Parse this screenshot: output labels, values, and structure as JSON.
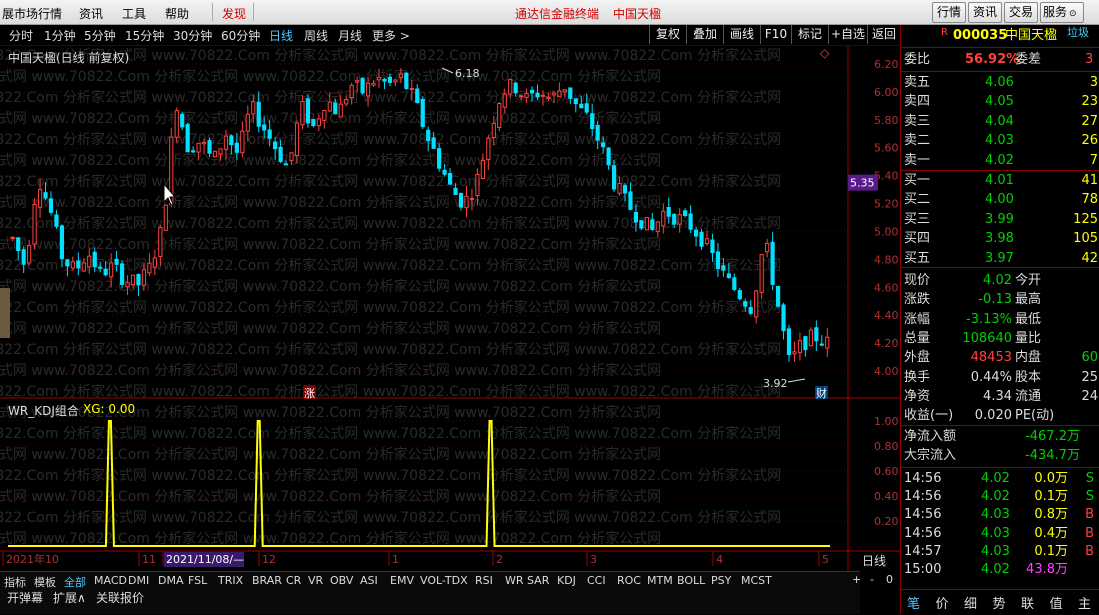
{
  "menu": {
    "items": [
      "展市场行情",
      "资讯",
      "工具",
      "帮助",
      "发现"
    ],
    "center_title": "通达信金融终端",
    "center_stock": "中国天楹",
    "right_buttons": [
      "行情",
      "资讯",
      "交易",
      "服务"
    ]
  },
  "periods": [
    "分时",
    "1分钟",
    "5分钟",
    "15分钟",
    "30分钟",
    "60分钟",
    "日线",
    "周线",
    "月线",
    "更多 >"
  ],
  "active_period": "日线",
  "toolbar_buttons": [
    "复权",
    "叠加",
    "画线",
    "F10",
    "标记",
    "+自选",
    "返回"
  ],
  "price_panel": {
    "title": "中国天楹(日线 前复权)",
    "y_ticks": [
      "6.20",
      "6.00",
      "5.80",
      "5.60",
      "5.40",
      "5.20",
      "5.00",
      "4.80",
      "4.60",
      "4.40",
      "4.20",
      "4.00"
    ],
    "current_tag": "5.35",
    "high_label": "6.18",
    "low_label": "3.92",
    "zhang_marker": "涨",
    "cai_marker": "财"
  },
  "indicator_panel": {
    "title": "WR_KDJ组合",
    "xg_label": "XG: 0.00",
    "y_ticks": [
      "1.00",
      "0.80",
      "0.60",
      "0.40",
      "0.20"
    ],
    "spikes_at": [
      0.124,
      0.305,
      0.587
    ]
  },
  "time_axis": {
    "labels": [
      "2021年10",
      "11",
      "2021/11/08/—",
      "12",
      "1",
      "2",
      "3",
      "4",
      "5"
    ],
    "right_label": "日线"
  },
  "indicator_tabs": [
    "指标",
    "模板",
    "全部",
    "MACD",
    "DMI",
    "DMA",
    "FSL",
    "TRIX",
    "BRAR",
    "CR",
    "VR",
    "OBV",
    "ASI",
    "EMV",
    "VOL-TDX",
    "RSI",
    "WR",
    "SAR",
    "KDJ",
    "CCI",
    "ROC",
    "MTM",
    "BOLL",
    "PSY",
    "MCST"
  ],
  "bottom_tabs": [
    "开弹幕",
    "扩展∧",
    "关联报价"
  ],
  "zoom_controls": [
    "+",
    "-",
    "0"
  ],
  "watermark": "www.70822.Com 分析家公式网",
  "quote": {
    "code": "000035",
    "name": "中国天楹",
    "trash_label": "垃圾",
    "r_badge": "R",
    "webi_label": "委比",
    "webi_value": "56.92%",
    "weicha_label": "委差",
    "weicha_value": "3",
    "asks": [
      {
        "label": "卖五",
        "price": "4.06",
        "vol": "3"
      },
      {
        "label": "卖四",
        "price": "4.05",
        "vol": "23"
      },
      {
        "label": "卖三",
        "price": "4.04",
        "vol": "27"
      },
      {
        "label": "卖二",
        "price": "4.03",
        "vol": "26"
      },
      {
        "label": "卖一",
        "price": "4.02",
        "vol": "7"
      }
    ],
    "bids": [
      {
        "label": "买一",
        "price": "4.01",
        "vol": "41"
      },
      {
        "label": "买二",
        "price": "4.00",
        "vol": "78"
      },
      {
        "label": "买三",
        "price": "3.99",
        "vol": "125"
      },
      {
        "label": "买四",
        "price": "3.98",
        "vol": "105"
      },
      {
        "label": "买五",
        "price": "3.97",
        "vol": "42"
      }
    ],
    "stats": [
      {
        "l1": "现价",
        "v1": "4.02",
        "l2": "今开"
      },
      {
        "l1": "涨跌",
        "v1": "-0.13",
        "l2": "最高"
      },
      {
        "l1": "涨幅",
        "v1": "-3.13%",
        "l2": "最低"
      },
      {
        "l1": "总量",
        "v1": "108640",
        "l2": "量比"
      },
      {
        "l1": "外盘",
        "v1": "48453",
        "l2": "内盘",
        "v2": "60"
      },
      {
        "l1": "换手",
        "v1": "0.44%",
        "l2": "股本",
        "v2": "25"
      },
      {
        "l1": "净资",
        "v1": "4.34",
        "l2": "流通",
        "v2": "24"
      },
      {
        "l1": "收益(一)",
        "v1": "0.020",
        "l2": "PE(动)"
      }
    ],
    "flows": [
      {
        "label": "净流入额",
        "value": "-467.2万"
      },
      {
        "label": "大宗流入",
        "value": "-434.7万"
      }
    ],
    "ticks": [
      {
        "time": "14:56",
        "price": "4.02",
        "vol": "0.0万",
        "side": "S"
      },
      {
        "time": "14:56",
        "price": "4.02",
        "vol": "0.1万",
        "side": "S"
      },
      {
        "time": "14:56",
        "price": "4.03",
        "vol": "0.8万",
        "side": "B"
      },
      {
        "time": "14:56",
        "price": "4.03",
        "vol": "0.4万",
        "side": "B"
      },
      {
        "time": "14:57",
        "price": "4.03",
        "vol": "0.1万",
        "side": "B"
      },
      {
        "time": "15:00",
        "price": "4.02",
        "vol": "43.8万",
        "side": ""
      }
    ],
    "bottom_tabs": [
      "笔",
      "价",
      "细",
      "势",
      "联",
      "值",
      "主"
    ]
  },
  "colors": {
    "up": "#ff4040",
    "down": "#00e0ff",
    "bg": "#000000",
    "grid": "#600000",
    "accent": "#4cc8ff"
  }
}
